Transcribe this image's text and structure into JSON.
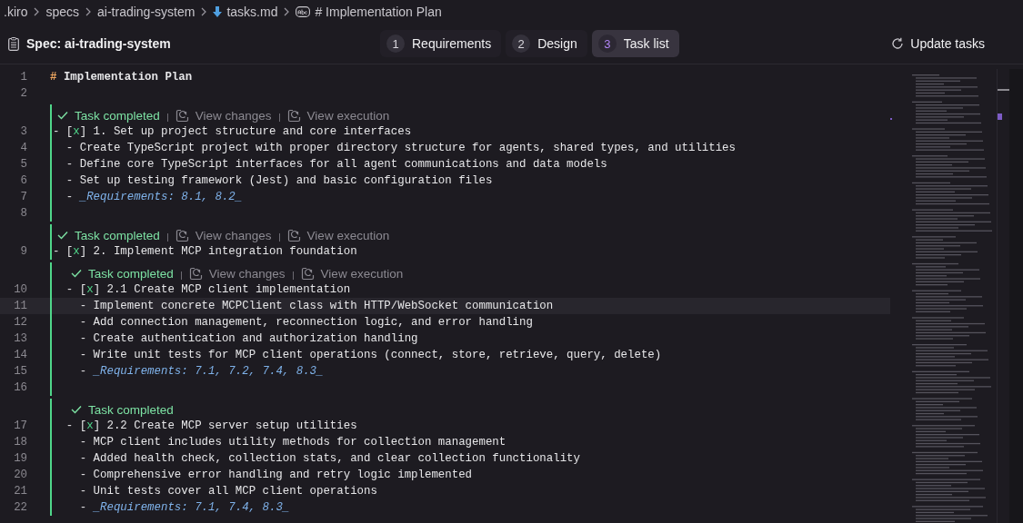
{
  "breadcrumbs": [
    {
      "label": ".kiro",
      "kind": "plain"
    },
    {
      "label": "specs",
      "kind": "plain"
    },
    {
      "label": "ai-trading-system",
      "kind": "plain"
    },
    {
      "label": "tasks.md",
      "kind": "file"
    },
    {
      "label": "# Implementation Plan",
      "kind": "symbol"
    }
  ],
  "header": {
    "spec_title": "Spec: ai-trading-system",
    "update_button": "Update tasks",
    "steps": [
      {
        "number": "1",
        "label": "Requirements",
        "selected": false
      },
      {
        "number": "2",
        "label": "Design",
        "selected": false
      },
      {
        "number": "3",
        "label": "Task list",
        "selected": true
      }
    ]
  },
  "editor": {
    "items": [
      {
        "kind": "heading",
        "number": "1",
        "marker": "#",
        "text": "Implementation Plan",
        "current": false
      },
      {
        "kind": "blank",
        "number": "2",
        "current": false
      },
      {
        "kind": "task",
        "completed": true,
        "status": "Task completed",
        "actions": [
          "View changes",
          "View execution"
        ],
        "lines": [
          {
            "number": "3",
            "kind": "checkbox",
            "prefix": "- [",
            "mark": "x",
            "rest": "] 1. Set up project structure and core interfaces",
            "checked": true,
            "current": false
          },
          {
            "number": "4",
            "kind": "bullet",
            "text": "  - Create TypeScript project with proper directory structure for agents, shared types, and utilities",
            "current": false
          },
          {
            "number": "5",
            "kind": "bullet",
            "text": "  - Define core TypeScript interfaces for all agent communications and data models",
            "current": false
          },
          {
            "number": "6",
            "kind": "bullet",
            "text": "  - Set up testing framework (Jest) and basic configuration files",
            "current": false
          },
          {
            "number": "7",
            "kind": "req",
            "prefix": "  - ",
            "text": "_Requirements: 8.1, 8.2_",
            "current": false
          },
          {
            "number": "8",
            "kind": "blank",
            "current": false
          }
        ]
      },
      {
        "kind": "task",
        "completed": true,
        "status": "Task completed",
        "actions": [
          "View changes",
          "View execution"
        ],
        "lines": [
          {
            "number": "9",
            "kind": "checkbox",
            "prefix": "- [",
            "mark": "x",
            "rest": "] 2. Implement MCP integration foundation",
            "checked": true,
            "current": false
          }
        ],
        "children": [
          {
            "kind": "task",
            "completed": true,
            "status": "Task completed",
            "actions": [
              "View changes",
              "View execution"
            ],
            "lines": [
              {
                "number": "10",
                "kind": "checkbox",
                "prefix": "  - [",
                "mark": "x",
                "rest": "] 2.1 Create MCP client implementation",
                "checked": true,
                "current": false
              },
              {
                "number": "11",
                "kind": "bullet",
                "text": "    - Implement concrete MCPClient class with HTTP/WebSocket communication",
                "current": true
              },
              {
                "number": "12",
                "kind": "bullet",
                "text": "    - Add connection management, reconnection logic, and error handling",
                "current": false
              },
              {
                "number": "13",
                "kind": "bullet",
                "text": "    - Create authentication and authorization handling",
                "current": false
              },
              {
                "number": "14",
                "kind": "bullet",
                "text": "    - Write unit tests for MCP client operations (connect, store, retrieve, query, delete)",
                "current": false
              },
              {
                "number": "15",
                "kind": "req",
                "prefix": "    - ",
                "text": "_Requirements: 7.1, 7.2, 7.4, 8.3_",
                "current": false
              },
              {
                "number": "16",
                "kind": "blank",
                "current": false
              }
            ]
          },
          {
            "kind": "task",
            "completed": true,
            "status": "Task completed",
            "lines": [
              {
                "number": "17",
                "kind": "checkbox",
                "prefix": "  - [",
                "mark": "x",
                "rest": "] 2.2 Create MCP server setup utilities",
                "checked": true,
                "current": false
              },
              {
                "number": "18",
                "kind": "bullet",
                "text": "    - MCP client includes utility methods for collection management",
                "current": false
              },
              {
                "number": "19",
                "kind": "bullet",
                "text": "    - Added health check, collection stats, and clear collection functionality",
                "current": false
              },
              {
                "number": "20",
                "kind": "bullet",
                "text": "    - Comprehensive error handling and retry logic implemented",
                "current": false
              },
              {
                "number": "21",
                "kind": "bullet",
                "text": "    - Unit tests cover all MCP client operations",
                "current": false
              },
              {
                "number": "22",
                "kind": "req",
                "prefix": "    - ",
                "text": "_Requirements: 7.1, 7.4, 8.3_",
                "current": false
              }
            ]
          }
        ]
      }
    ]
  }
}
